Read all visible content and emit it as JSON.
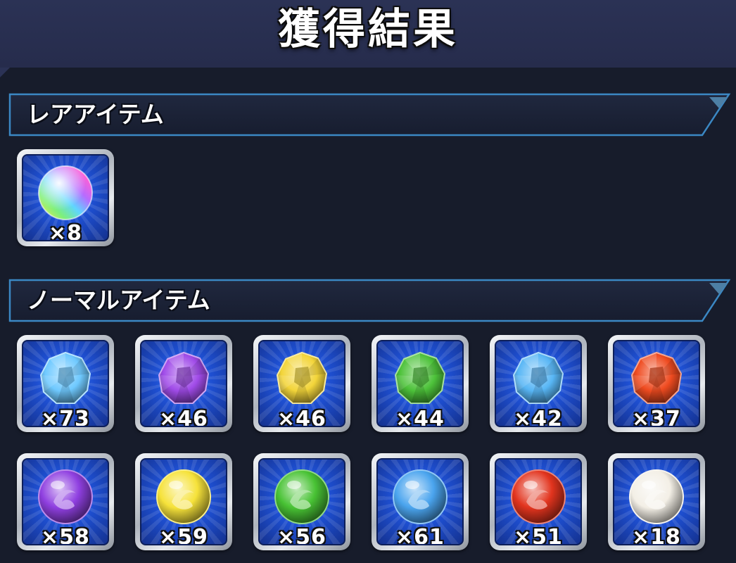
{
  "title": "獲得結果",
  "rare_section": {
    "label": "レアアイテム",
    "items": [
      {
        "icon": "rainbow-orb-icon",
        "qty": "×8",
        "color": "#ffffff"
      }
    ]
  },
  "normal_section": {
    "label": "ノーマルアイテム",
    "items": [
      {
        "icon": "blue-crystal-icon",
        "qty": "×73",
        "color": "#6fc9ff"
      },
      {
        "icon": "purple-crystal-icon",
        "qty": "×46",
        "color": "#a04be8"
      },
      {
        "icon": "yellow-crystal-icon",
        "qty": "×46",
        "color": "#f3d53a"
      },
      {
        "icon": "green-crystal-icon",
        "qty": "×44",
        "color": "#4dc23a"
      },
      {
        "icon": "light-blue-crystal-icon",
        "qty": "×42",
        "color": "#58b6f5"
      },
      {
        "icon": "red-crystal-icon",
        "qty": "×37",
        "color": "#ef4b20"
      },
      {
        "icon": "purple-orb-icon",
        "qty": "×58",
        "color": "#8f3fe0"
      },
      {
        "icon": "yellow-orb-icon",
        "qty": "×59",
        "color": "#f6e23a"
      },
      {
        "icon": "green-orb-icon",
        "qty": "×56",
        "color": "#48c234"
      },
      {
        "icon": "blue-orb-icon",
        "qty": "×61",
        "color": "#4aa4ee"
      },
      {
        "icon": "red-orb-icon",
        "qty": "×51",
        "color": "#e2341e"
      },
      {
        "icon": "white-orb-icon",
        "qty": "×18",
        "color": "#f3efe6"
      }
    ]
  }
}
